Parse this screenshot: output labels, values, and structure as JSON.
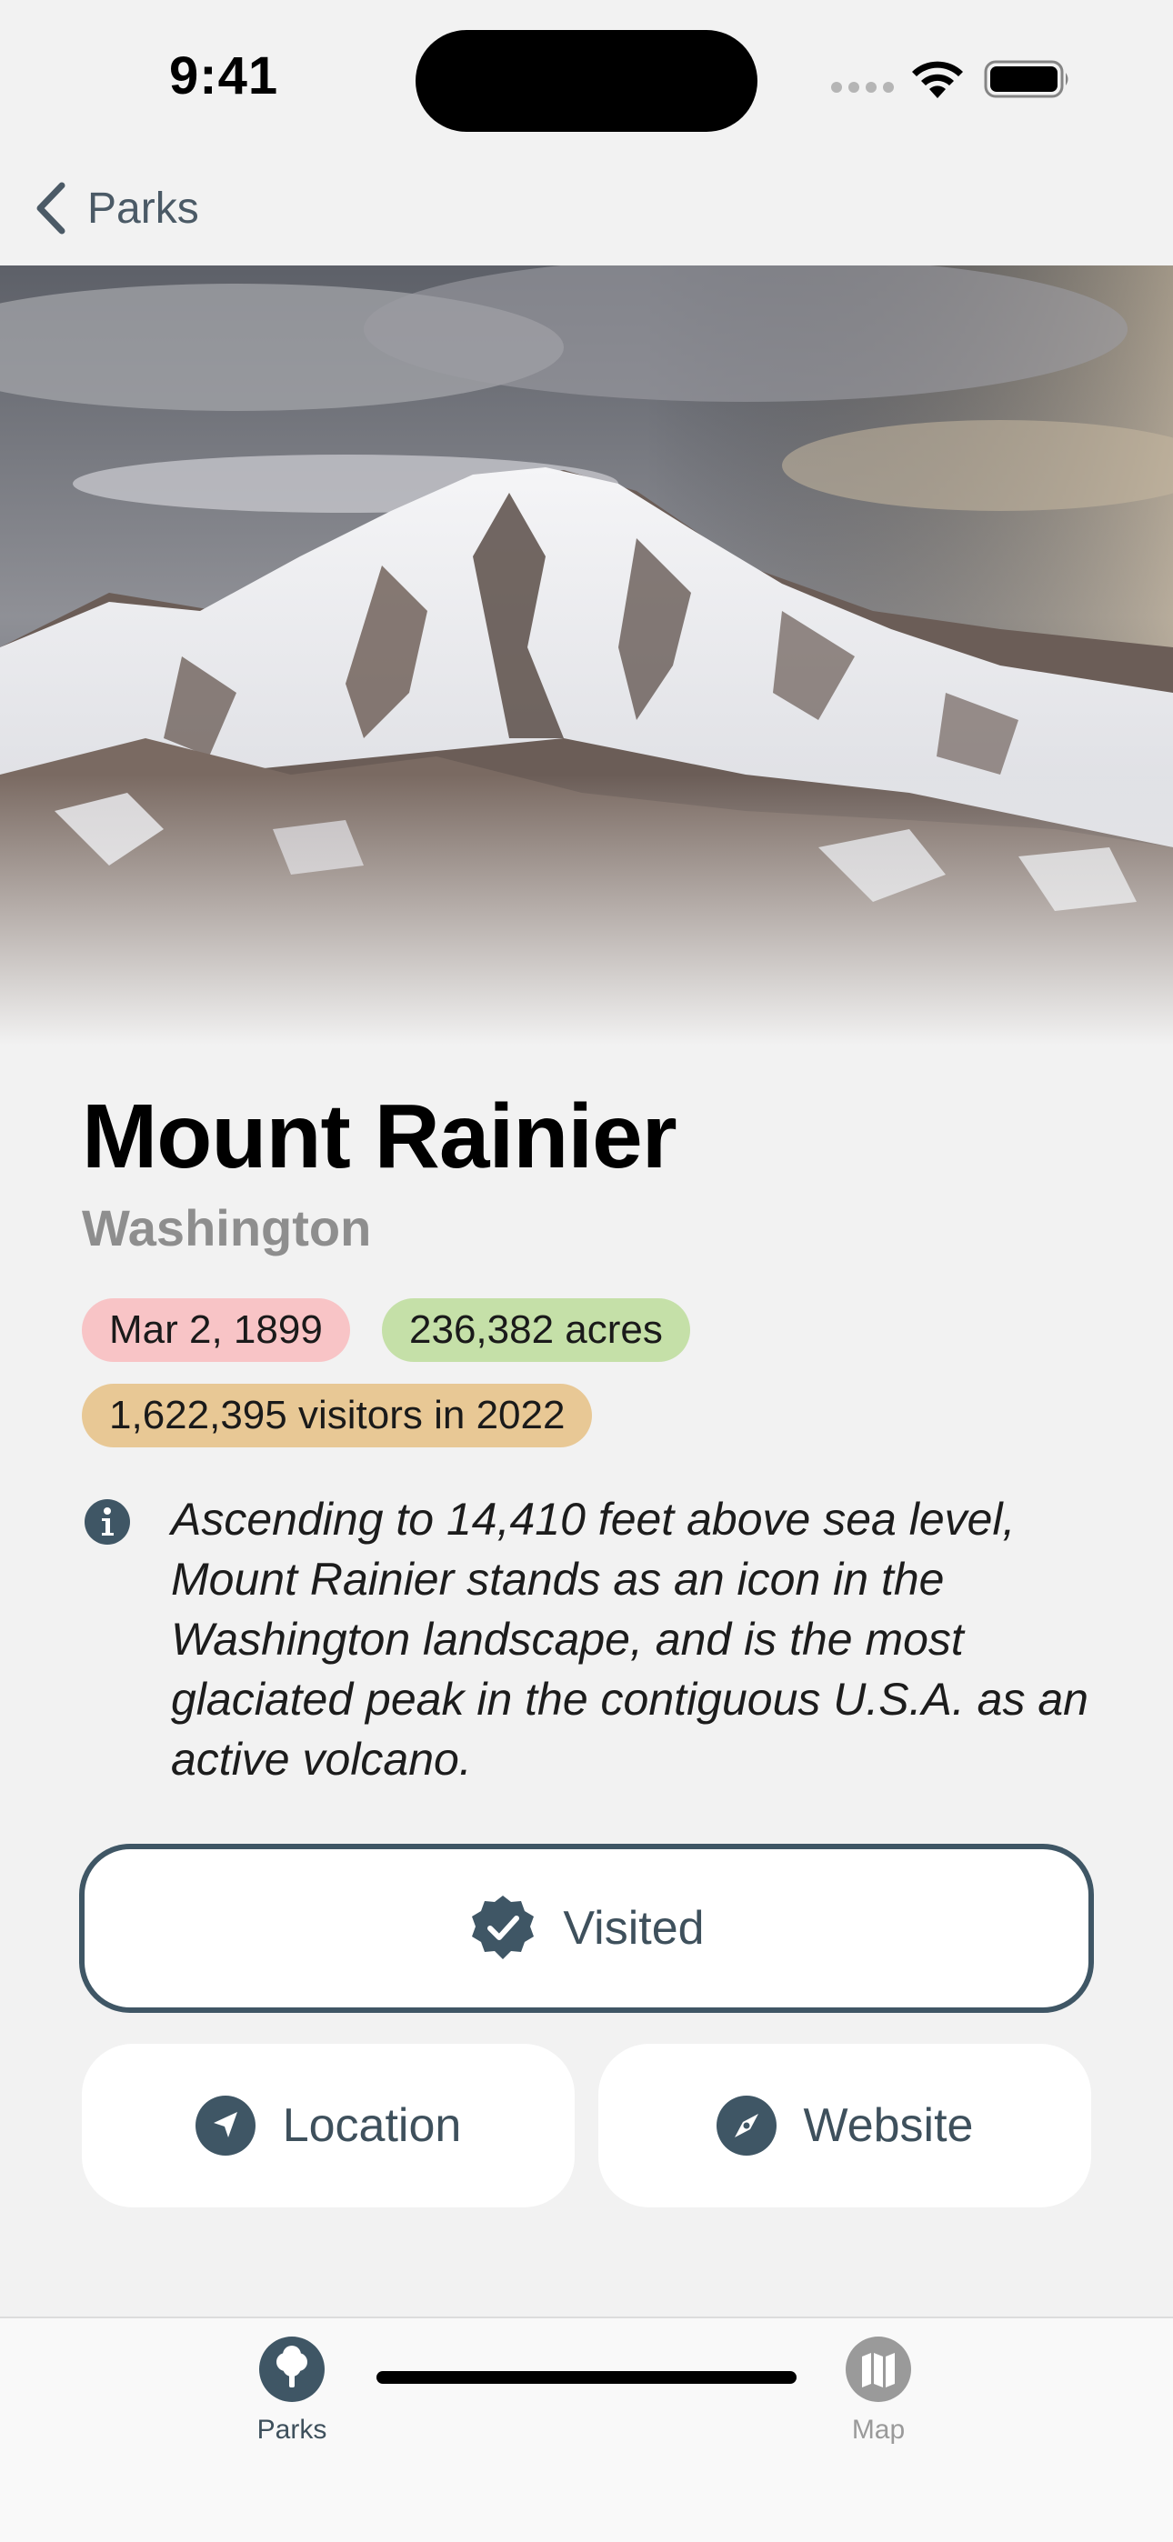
{
  "status_bar": {
    "time": "9:41"
  },
  "nav": {
    "back_label": "Parks"
  },
  "park": {
    "name": "Mount Rainier",
    "state": "Washington",
    "date_badge": "Mar 2, 1899",
    "acres_badge": "236,382 acres",
    "visitors_badge": "1,622,395 visitors in 2022",
    "description": "Ascending to 14,410 feet above sea level, Mount Rainier stands as an icon in the Washington landscape, and is the most glaciated peak in the contiguous U.S.A. as an active volcano."
  },
  "actions": {
    "visited_label": "Visited",
    "location_label": "Location",
    "website_label": "Website"
  },
  "tabs": [
    {
      "label": "Parks",
      "icon": "tree-icon",
      "selected": true
    },
    {
      "label": "Map",
      "icon": "map-icon",
      "selected": false
    }
  ],
  "colors": {
    "accent": "#3f5665",
    "date_badge": "#f8c4c6",
    "acres_badge": "#c5e0a8",
    "visitors_badge": "#e8c895",
    "background": "#f2f2f2"
  }
}
